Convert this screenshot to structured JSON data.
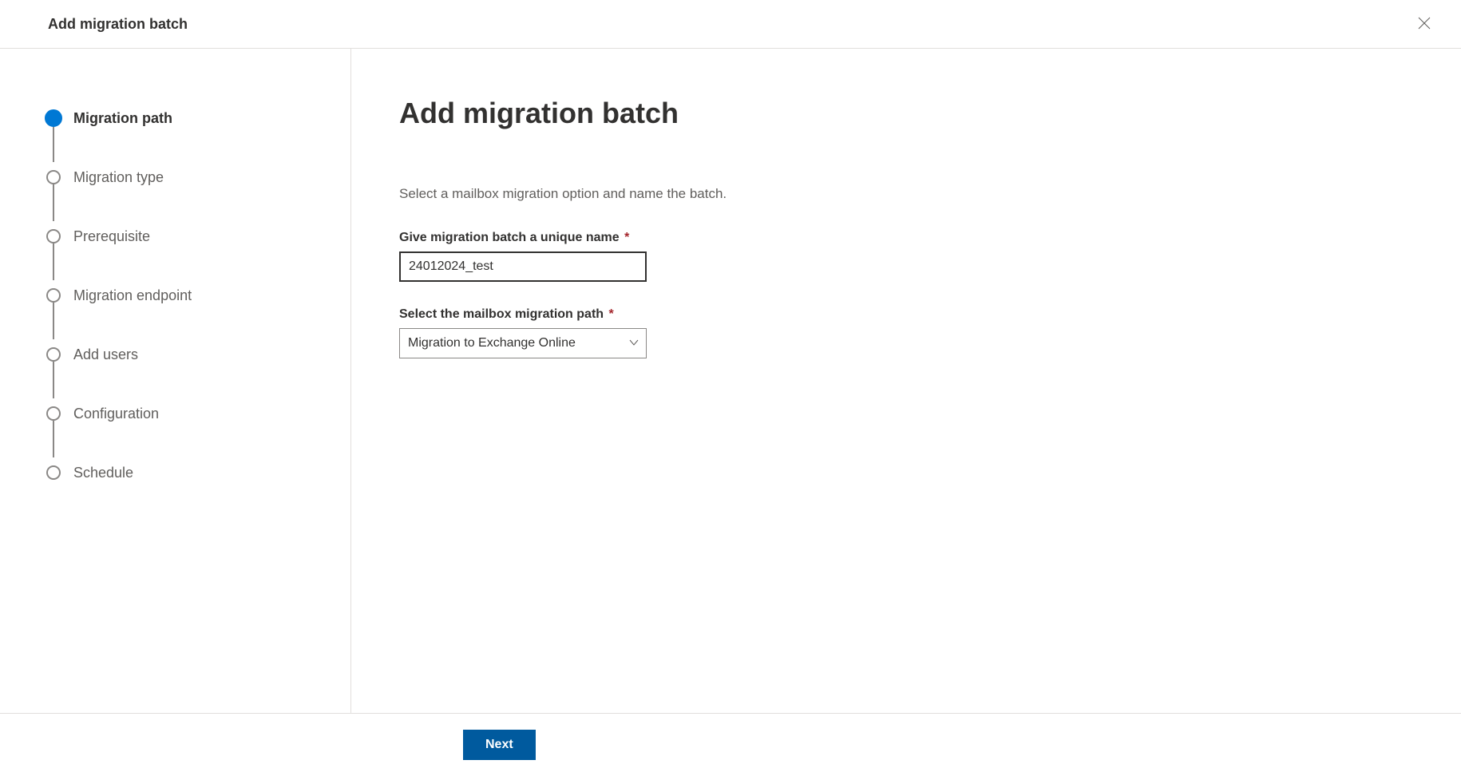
{
  "header": {
    "title": "Add migration batch"
  },
  "sidebar": {
    "steps": [
      {
        "label": "Migration path",
        "active": true
      },
      {
        "label": "Migration type",
        "active": false
      },
      {
        "label": "Prerequisite",
        "active": false
      },
      {
        "label": "Migration endpoint",
        "active": false
      },
      {
        "label": "Add users",
        "active": false
      },
      {
        "label": "Configuration",
        "active": false
      },
      {
        "label": "Schedule",
        "active": false
      }
    ]
  },
  "main": {
    "title": "Add migration batch",
    "description": "Select a mailbox migration option and name the batch.",
    "name_label": "Give migration batch a unique name",
    "name_value": "24012024_test",
    "path_label": "Select the mailbox migration path",
    "path_value": "Migration to Exchange Online"
  },
  "footer": {
    "next_label": "Next"
  }
}
